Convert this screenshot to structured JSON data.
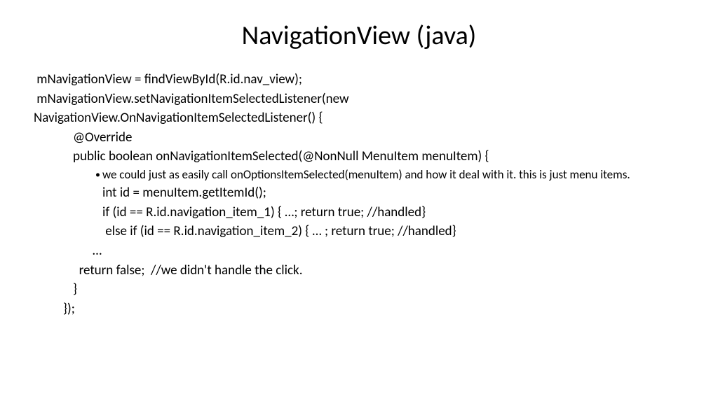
{
  "title": "NavigationView (java)",
  "lines": {
    "l1": " mNavigationView = findViewById(R.id.nav_view);",
    "l2": " mNavigationView.setNavigationItemSelectedListener(new",
    "l3": "NavigationView.OnNavigationItemSelectedListener() {",
    "l4": "@Override",
    "l5": "public boolean onNavigationItemSelected(@NonNull MenuItem menuItem) {",
    "bullet": "we could just as easily call onOptionsItemSelected(menuItem) and how it deal with it.  this is just menu items.",
    "l6": "int id = menuItem.getItemId();",
    "l7": "if (id == R.id.navigation_item_1) { …; return true; //handled}",
    "l8": " else if (id == R.id.navigation_item_2) { … ; return true; //handled}",
    "l9": "…",
    "l10": "  return false;  //we didn't handle the click.",
    "l11": "}",
    "l12": "});"
  }
}
